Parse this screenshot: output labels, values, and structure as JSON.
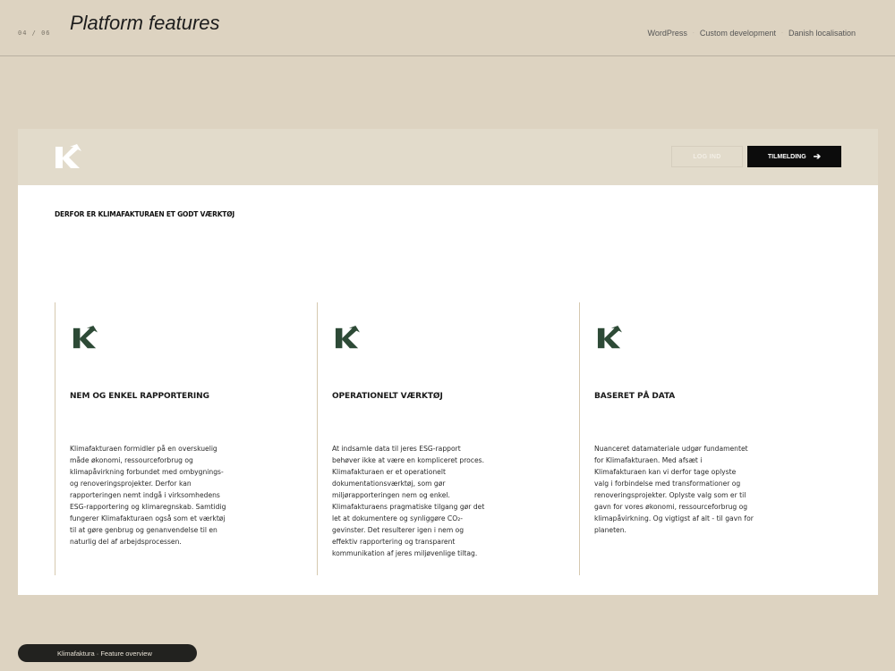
{
  "slide": {
    "page_number": "04 / 06",
    "title": "Platform features",
    "tags": [
      "WordPress",
      "Custom development",
      "Danish localisation"
    ],
    "footer": "Klimafaktura · Feature overview"
  },
  "site": {
    "header": {
      "logo": "klimafakturaen-k-logo-icon",
      "login_label": "LOG IND",
      "signup_label": "TILMELDING",
      "signup_icon": "arrow-right-icon"
    },
    "section_heading": "DERFOR ER KLIMAFAKTURAEN ET GODT VÆRKTØJ",
    "cards": [
      {
        "icon": "klimafakturaen-k-logo-icon",
        "title": "NEM OG ENKEL RAPPORTERING",
        "text": "Klimafakturaen formidler på en overskuelig\nmåde økonomi, ressourceforbrug og\nklimapåvirkning forbundet med ombygnings-\nog renoveringsprojekter. Derfor kan\nrapporteringen nemt indgå i virksomhedens\nESG-rapportering og klimaregnskab. Samtidig\nfungerer Klimafakturaen også som et værktøj\ntil at gøre genbrug og genanvendelse til en\nnaturlig del af arbejdsprocessen."
      },
      {
        "icon": "klimafakturaen-k-logo-icon",
        "title": "OPERATIONELT VÆRKTØJ",
        "text": "At indsamle data til jeres ESG-rapport\nbehøver ikke at være en kompliceret proces.\nKlimafakturaen er et operationelt\ndokumentationsværktøj, som gør\nmiljørapporteringen nem og enkel.\nKlimafakturaens pragmatiske tilgang gør det\nlet at dokumentere og synliggøre CO₂-\ngevinster. Det resulterer igen i nem og\neffektiv rapportering og transparent\nkommunikation af jeres miljøvenlige tiltag."
      },
      {
        "icon": "klimafakturaen-k-logo-icon",
        "title": "BASERET PÅ DATA",
        "text": "Nuanceret datamateriale udgør fundamentet\nfor Klimafakturaen. Med afsæt i\nKlimafakturaen kan vi derfor tage oplyste\nvalg i forbindelse med transformationer og\nrenoveringsprojekter. Oplyste valg som er til\ngavn for vores økonomi, ressourceforbrug og\nklimapåvirkning. Og vigtigst af alt - til gavn for\nplaneten."
      }
    ]
  },
  "colors": {
    "background": "#ddd3c1",
    "site_header": "#e2dbcb",
    "brand_green": "#2d4a36",
    "button_dark": "#0c0c0c"
  }
}
